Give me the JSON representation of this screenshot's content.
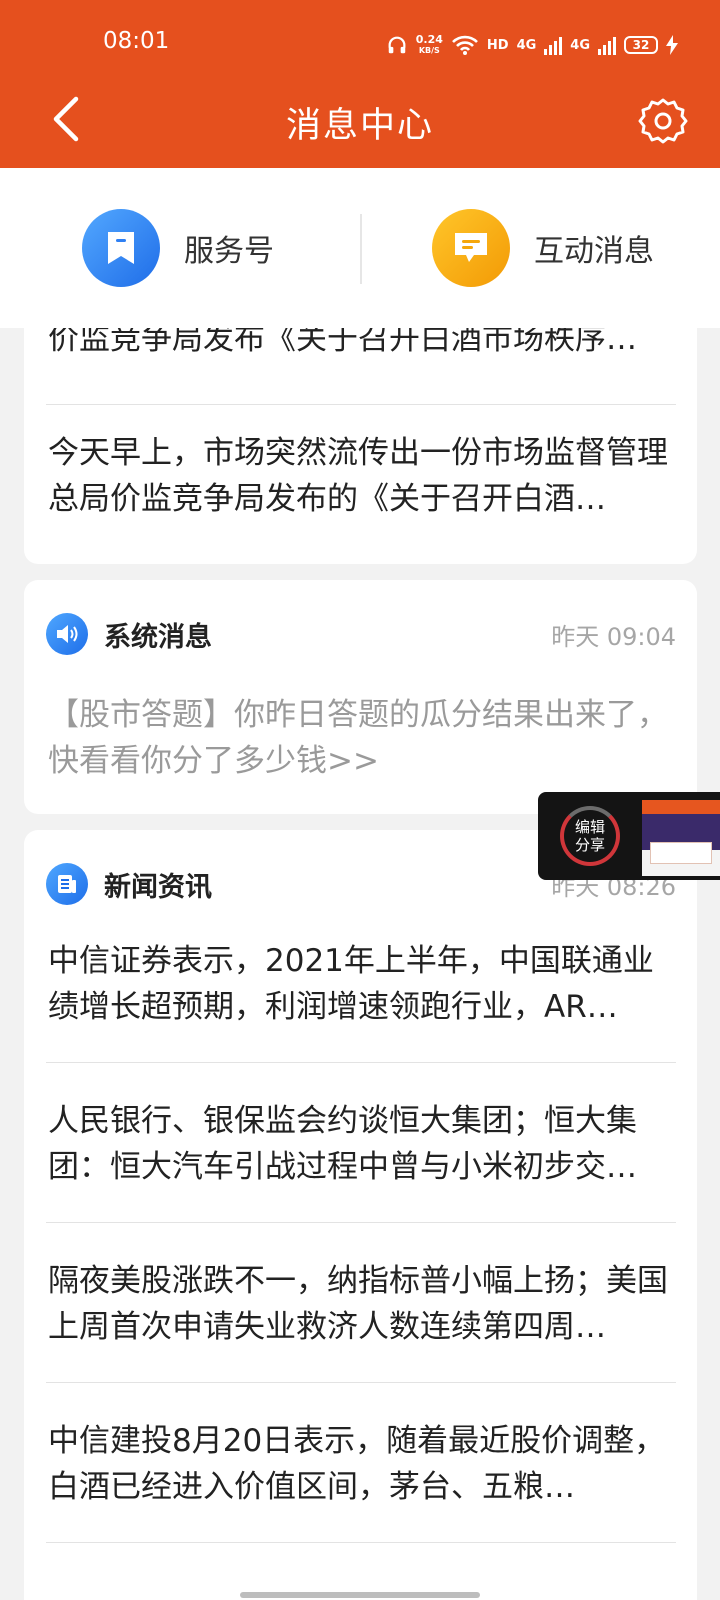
{
  "status_bar": {
    "time": "08:01",
    "speed_value": "0.24",
    "speed_unit": "KB/S",
    "hd": "HD",
    "net1": "4G",
    "net2": "4G",
    "battery": "32"
  },
  "header": {
    "title": "消息中心"
  },
  "tabs": [
    {
      "label": "服务号",
      "icon": "bookmark-icon",
      "color": "#2f80f3"
    },
    {
      "label": "互动消息",
      "icon": "chat-icon",
      "color": "#f5a70b"
    }
  ],
  "card_top": {
    "items": [
      "价监竞争局发布《关于召开白酒市场秩序…",
      "今天早上，市场突然流传出一份市场监督管理总局价监竞争局发布的《关于召开白酒…"
    ]
  },
  "system_card": {
    "name": "系统消息",
    "time": "昨天 09:04",
    "text": "【股市答题】你昨日答题的瓜分结果出来了，快看看你分了多少钱>>"
  },
  "news_card": {
    "name": "新闻资讯",
    "time": "昨天 08:26",
    "items": [
      "中信证券表示，2021年上半年，中国联通业绩增长超预期，利润增速领跑行业，AR…",
      "人民银行、银保监会约谈恒大集团；恒大集团：恒大汽车引战过程中曾与小米初步交…",
      "隔夜美股涨跌不一，纳指标普小幅上扬；美国上周首次申请失业救济人数连续第四周…",
      "中信建投8月20日表示，随着最近股价调整，白酒已经进入价值区间，茅台、五粮…"
    ]
  },
  "floater": {
    "line1": "编辑",
    "line2": "分享"
  },
  "colors": {
    "brand": "#e5501e",
    "muted_text": "#a6a6a6"
  }
}
